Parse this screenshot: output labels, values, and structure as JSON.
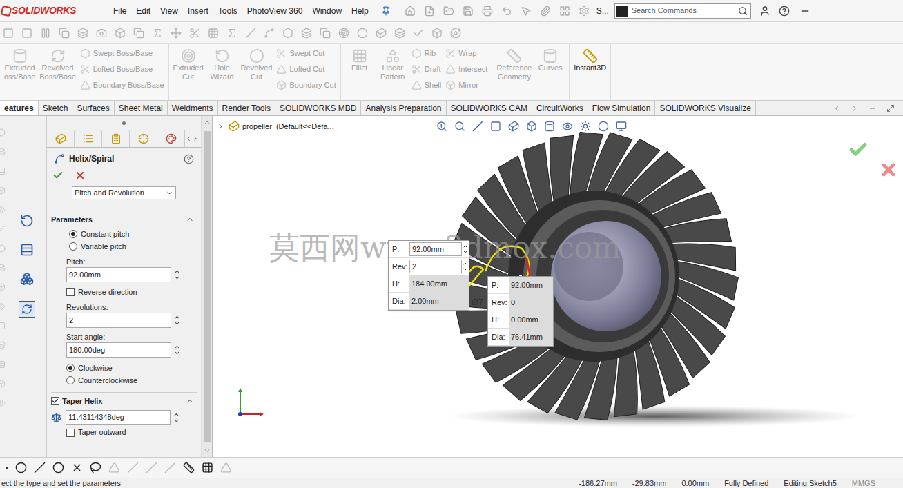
{
  "app": {
    "logo": "SOLIDWORKS",
    "menu": [
      "File",
      "Edit",
      "View",
      "Insert",
      "Tools",
      "PhotoView 360",
      "Window",
      "Help"
    ],
    "truncated_label": "S...",
    "search": {
      "placeholder": "Search Commands"
    }
  },
  "ribbon": [
    [
      {
        "kind": "large",
        "lines": [
          "Extruded",
          "oss/Base"
        ],
        "disabled": true
      },
      {
        "kind": "large",
        "lines": [
          "Revolved",
          "Boss/Base"
        ],
        "disabled": true
      },
      {
        "kind": "stack",
        "items": [
          {
            "label": "Swept Boss/Base",
            "disabled": true
          },
          {
            "label": "Lofted Boss/Base",
            "disabled": true
          },
          {
            "label": "Boundary Boss/Base",
            "disabled": true
          }
        ]
      }
    ],
    [
      {
        "kind": "large",
        "lines": [
          "Extruded",
          "Cut"
        ],
        "disabled": true
      },
      {
        "kind": "large",
        "lines": [
          "Hole",
          "Wizard"
        ],
        "disabled": true
      },
      {
        "kind": "large",
        "lines": [
          "Revolved",
          "Cut"
        ],
        "disabled": true
      },
      {
        "kind": "stack",
        "items": [
          {
            "label": "Swept Cut",
            "disabled": true
          },
          {
            "label": "Lofted Cut",
            "disabled": true
          },
          {
            "label": "Boundary Cut",
            "disabled": true
          }
        ]
      }
    ],
    [
      {
        "kind": "large",
        "lines": [
          "Fillet"
        ],
        "disabled": true
      },
      {
        "kind": "large",
        "lines": [
          "Linear",
          "Pattern"
        ],
        "disabled": true
      },
      {
        "kind": "stack",
        "items": [
          {
            "label": "Rib",
            "disabled": true
          },
          {
            "label": "Draft",
            "disabled": true
          },
          {
            "label": "Shell",
            "disabled": true
          }
        ]
      },
      {
        "kind": "stack",
        "items": [
          {
            "label": "Wrap",
            "disabled": true
          },
          {
            "label": "Intersect",
            "disabled": true
          },
          {
            "label": "Mirror",
            "disabled": true
          }
        ]
      }
    ],
    [
      {
        "kind": "large",
        "lines": [
          "Reference",
          "Geometry"
        ],
        "disabled": true
      },
      {
        "kind": "large",
        "lines": [
          "Curves"
        ],
        "disabled": true
      }
    ],
    [
      {
        "kind": "large",
        "lines": [
          "Instant3D"
        ],
        "disabled": false
      }
    ]
  ],
  "command_tabs": [
    {
      "label": "eatures",
      "selected": true
    },
    {
      "label": "Sketch",
      "selected": false
    },
    {
      "label": "Surfaces",
      "selected": false
    },
    {
      "label": "Sheet Metal",
      "selected": false
    },
    {
      "label": "Weldments",
      "selected": false
    },
    {
      "label": "Render Tools",
      "selected": false
    },
    {
      "label": "SOLIDWORKS MBD",
      "selected": false
    },
    {
      "label": "Analysis Preparation",
      "selected": false
    },
    {
      "label": "SOLIDWORKS CAM",
      "selected": false
    },
    {
      "label": "CircuitWorks",
      "selected": false
    },
    {
      "label": "Flow Simulation",
      "selected": false
    },
    {
      "label": "SOLIDWORKS Visualize",
      "selected": false
    }
  ],
  "property_manager": {
    "title": "Helix/Spiral",
    "type_select": "Pitch and Revolution",
    "parameters": {
      "title": "Parameters",
      "expanded": true,
      "pitch_modes": [
        {
          "label": "Constant pitch",
          "selected": true
        },
        {
          "label": "Variable pitch",
          "selected": false
        }
      ],
      "pitch": {
        "label": "Pitch:",
        "value": "92.00mm"
      },
      "reverse_direction": {
        "label": "Reverse direction",
        "checked": false
      },
      "revolutions": {
        "label": "Revolutions:",
        "value": "2"
      },
      "start_angle": {
        "label": "Start angle:",
        "value": "180.00deg"
      },
      "directions": [
        {
          "label": "Clockwise",
          "selected": true
        },
        {
          "label": "Counterclockwise",
          "selected": false
        }
      ]
    },
    "taper": {
      "title": "Taper Helix",
      "checked": true,
      "expanded": true,
      "angle": "11.43114348deg",
      "taper_outward": {
        "label": "Taper outward",
        "checked": false
      }
    }
  },
  "viewport": {
    "breadcrumb": "propeller  (Default<<Defa...",
    "watermark": "莫西网www.3dmox.com",
    "dimension": "Ø7",
    "callouts": [
      {
        "rows": [
          {
            "label": "P:",
            "value": "92.00mm",
            "spinner": true
          },
          {
            "label": "Rev:",
            "value": "2",
            "spinner": true
          },
          {
            "label": "H:",
            "value": "184.00mm",
            "spinner": false
          },
          {
            "label": "Dia:",
            "value": "2.00mm",
            "spinner": false
          }
        ]
      },
      {
        "rows": [
          {
            "label": "P:",
            "value": "92.00mm",
            "spinner": false
          },
          {
            "label": "Rev:",
            "value": "0",
            "spinner": false
          },
          {
            "label": "H:",
            "value": "0.00mm",
            "spinner": false
          },
          {
            "label": "Dia:",
            "value": "76.41mm",
            "spinner": false
          }
        ]
      }
    ]
  },
  "status_bar": {
    "message": "ect the type and set the parameters",
    "fields": [
      "-186.27mm",
      "-29.83mm",
      "0.00mm",
      "Fully Defined",
      "Editing Sketch5",
      "MMGS"
    ]
  }
}
